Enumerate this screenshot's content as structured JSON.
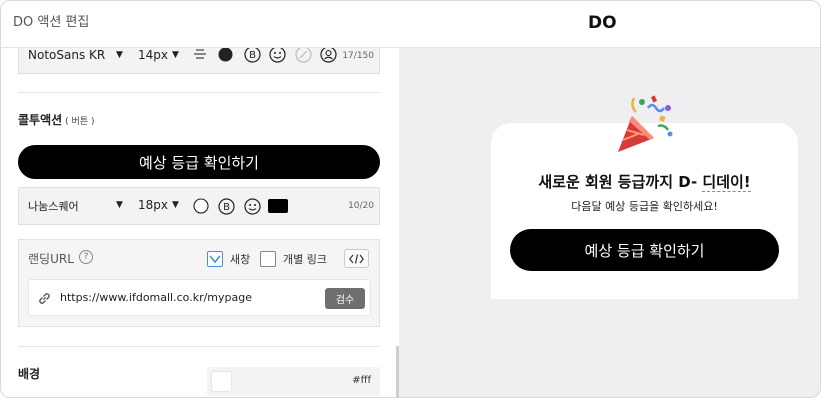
{
  "window": {
    "title": "DO 액션 편집",
    "brand": "DO"
  },
  "title_font_row": {
    "font_name": "NotoSans KR",
    "font_size": "14px",
    "char_count": "17/150",
    "icons": [
      "align-center-icon",
      "text-color-dot-icon",
      "bold-circle-icon",
      "emoji-icon",
      "highlight-disabled-icon",
      "user-circle-icon"
    ]
  },
  "callout": {
    "label": "콜투액션",
    "sublabel": "( 버튼 )",
    "button_text": "예상 등급 확인하기",
    "font_name": "나눔스퀘어",
    "font_size": "18px",
    "char_count": "10/20",
    "color_swatch": "#000000"
  },
  "landing": {
    "label": "랜딩URL",
    "help": "?",
    "new_window_label": "새창",
    "new_window_checked": true,
    "individual_link_label": "개별 링크",
    "individual_link_checked": false,
    "url": "https://www.ifdomall.co.kr/mypage",
    "verify_label": "검수"
  },
  "background": {
    "label": "배경",
    "value": "#fff"
  },
  "preview": {
    "headline_prefix": "새로운 회원 등급까지 D- ",
    "headline_dday": "디데이!",
    "subline": "다음달 예상 등급을 확인하세요!",
    "button_text": "예상 등급 확인하기",
    "icon": "party-popper-icon"
  },
  "colors": {
    "accent": "#000000",
    "preview_bg": "#efeff1",
    "checkbox_accent": "#4a90d9"
  }
}
